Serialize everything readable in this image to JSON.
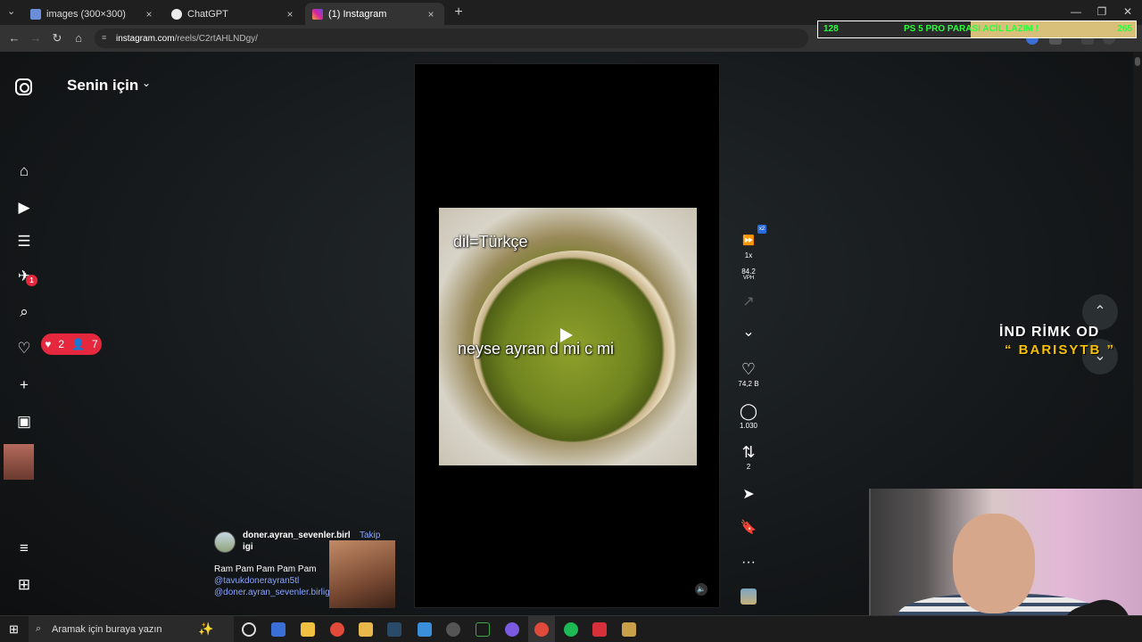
{
  "browser": {
    "tabs": [
      {
        "title": "images (300×300)",
        "close": "×"
      },
      {
        "title": "ChatGPT",
        "close": "×"
      },
      {
        "title": "(1) Instagram",
        "close": "×",
        "active": true
      }
    ],
    "new_tab": "+",
    "url_host": "instagram.com",
    "url_path": "/reels/C2rtAHLNDgy/",
    "window_controls": [
      "—",
      "❐",
      "✕"
    ]
  },
  "overlay_banner": {
    "left_value": "128",
    "message": "PS 5 PRO PARASI ACİL LAZIM !",
    "right_value": "265",
    "progress_fraction": 0.48
  },
  "sidebar": {
    "logo": "instagram-icon",
    "items": [
      {
        "name": "home",
        "icon": "⌂"
      },
      {
        "name": "reels",
        "icon": "▶"
      },
      {
        "name": "feed-filter",
        "icon": "☰"
      },
      {
        "name": "messages",
        "icon": "✈",
        "badge": "1"
      },
      {
        "name": "search",
        "icon": "⌕"
      },
      {
        "name": "notifications",
        "icon": "♡"
      },
      {
        "name": "create",
        "icon": "+"
      },
      {
        "name": "dashboard",
        "icon": "▣"
      }
    ],
    "notification_pill": {
      "likes": "2",
      "follows": "7"
    },
    "bottom_items": [
      {
        "name": "more",
        "icon": "≡"
      },
      {
        "name": "also-from-meta",
        "icon": "⊞"
      }
    ]
  },
  "feed": {
    "title": "Senin için",
    "chevron": "⌄"
  },
  "reel": {
    "overlay_text_top": "dil=Türkçe",
    "overlay_text_bottom": "neyse ayran d mi c mi",
    "author": "doner.ayran_sevenler.birligi",
    "follow": "Takip Et",
    "caption_line": "Ram Pam Pam Pam Pam",
    "tags": [
      "@tavukdonerayran5tl",
      "@doner.ayran_sevenler.birligi"
    ],
    "sound_icon": "🔈"
  },
  "actions": {
    "speed": {
      "icon": "⏩",
      "label": "1x"
    },
    "vph": {
      "value": "84.2",
      "unit": "VPH"
    },
    "trend_icon": "↗",
    "collapse_icon": "⌄",
    "like": {
      "icon": "♡",
      "count": "74,2 B"
    },
    "comment": {
      "icon": "◯",
      "count": "1.030"
    },
    "repost": {
      "icon": "⇅",
      "count": "2"
    },
    "share_icon": "➤",
    "save_icon": "🔖",
    "more_icon": "···"
  },
  "navigation": {
    "up": "⌃",
    "down": "⌄"
  },
  "watermark": {
    "line1": "İND RİMK OD",
    "line2": "“ BARISYTB ”"
  },
  "taskbar": {
    "search_placeholder": "Aramak için buraya yazın",
    "start_icon": "⊞",
    "search_icon": "⌕",
    "spark_icon": "✨"
  },
  "colors": {
    "accent_red": "#e5283e",
    "link_blue": "#8aa4ff",
    "banner_green": "#28ff3b",
    "watermark_yellow": "#f6c000"
  }
}
